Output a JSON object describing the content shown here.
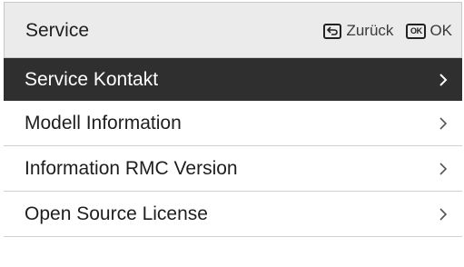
{
  "header": {
    "title": "Service",
    "back_label": "Zurück",
    "ok_icon_text": "OK",
    "ok_label": "OK"
  },
  "menu": {
    "items": [
      {
        "label": "Service Kontakt",
        "selected": true
      },
      {
        "label": "Modell Information",
        "selected": false
      },
      {
        "label": "Information RMC Version",
        "selected": false
      },
      {
        "label": "Open Source License",
        "selected": false
      }
    ]
  },
  "colors": {
    "header_bg": "#ebebeb",
    "selected_bg": "#2f2f2f",
    "text": "#1e1e1e",
    "divider": "#d0d0d0"
  },
  "icons": {
    "back": "back-arrow-icon",
    "ok": "ok-key-icon",
    "item_arrow": "chevron-right-icon"
  }
}
